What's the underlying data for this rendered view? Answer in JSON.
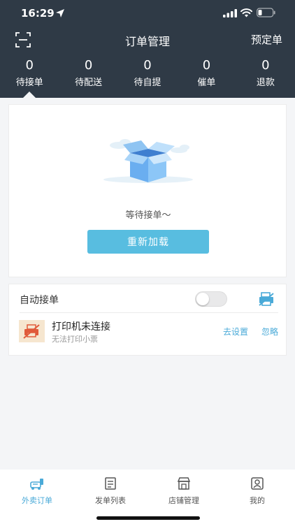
{
  "status_bar": {
    "time": "16:29"
  },
  "nav": {
    "title": "订单管理",
    "right_action": "预定单"
  },
  "stats": [
    {
      "count": "0",
      "label": "待接单"
    },
    {
      "count": "0",
      "label": "待配送"
    },
    {
      "count": "0",
      "label": "待自提"
    },
    {
      "count": "0",
      "label": "催单"
    },
    {
      "count": "0",
      "label": "退款"
    }
  ],
  "empty_state": {
    "message": "等待接单～",
    "reload_label": "重新加载"
  },
  "auto_accept": {
    "label": "自动接单",
    "enabled": false
  },
  "printer": {
    "title": "打印机未连接",
    "subtitle": "无法打印小票",
    "settings_label": "去设置",
    "ignore_label": "忽略"
  },
  "tabs": [
    {
      "label": "外卖订单",
      "active": true,
      "icon": "takeout-icon"
    },
    {
      "label": "发单列表",
      "active": false,
      "icon": "list-icon"
    },
    {
      "label": "店铺管理",
      "active": false,
      "icon": "store-icon"
    },
    {
      "label": "我的",
      "active": false,
      "icon": "profile-icon"
    }
  ],
  "colors": {
    "header_bg": "#2f3a46",
    "accent": "#4aaad8",
    "button": "#58bde0"
  }
}
